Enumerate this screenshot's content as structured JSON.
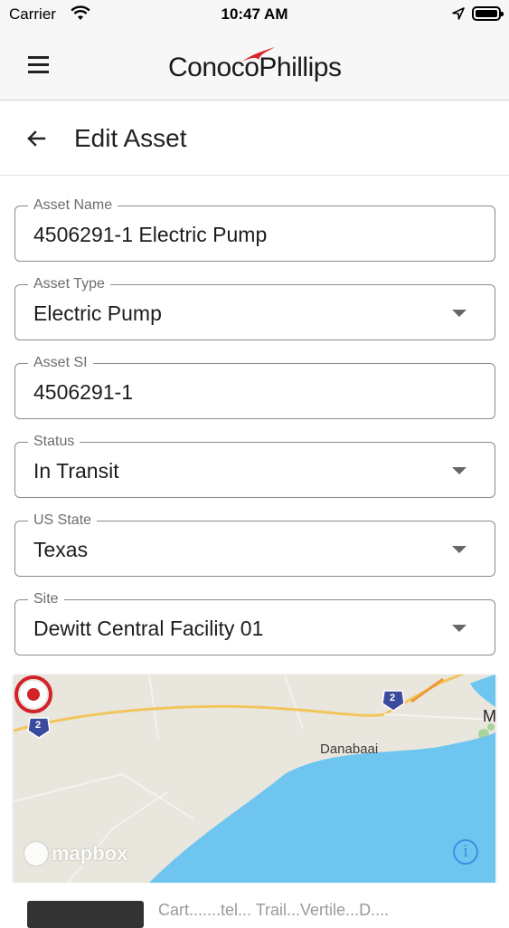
{
  "status_bar": {
    "carrier": "Carrier",
    "time": "10:47 AM"
  },
  "app_bar": {
    "logo_text": "ConocoPhillips",
    "brand_red": "#d6252b"
  },
  "page": {
    "title": "Edit Asset"
  },
  "fields": {
    "asset_name": {
      "label": "Asset Name",
      "value": "4506291-1 Electric Pump"
    },
    "asset_type": {
      "label": "Asset Type",
      "value": "Electric Pump"
    },
    "asset_si": {
      "label": "Asset SI",
      "value": "4506291-1"
    },
    "status": {
      "label": "Status",
      "value": "In Transit"
    },
    "us_state": {
      "label": "US State",
      "value": "Texas"
    },
    "site": {
      "label": "Site",
      "value": "Dewitt Central Facility 01"
    }
  },
  "map": {
    "place_label": "Danabaai",
    "place_label_partial": "M",
    "road_shield_1": "2",
    "road_shield_2": "2",
    "attribution": "mapbox",
    "info_symbol": "i",
    "water_color": "#6ec6f0",
    "marker_color": "#d3222a"
  },
  "bottom": {
    "text": "Cart.......tel...  Trail...Vertile...D...."
  }
}
